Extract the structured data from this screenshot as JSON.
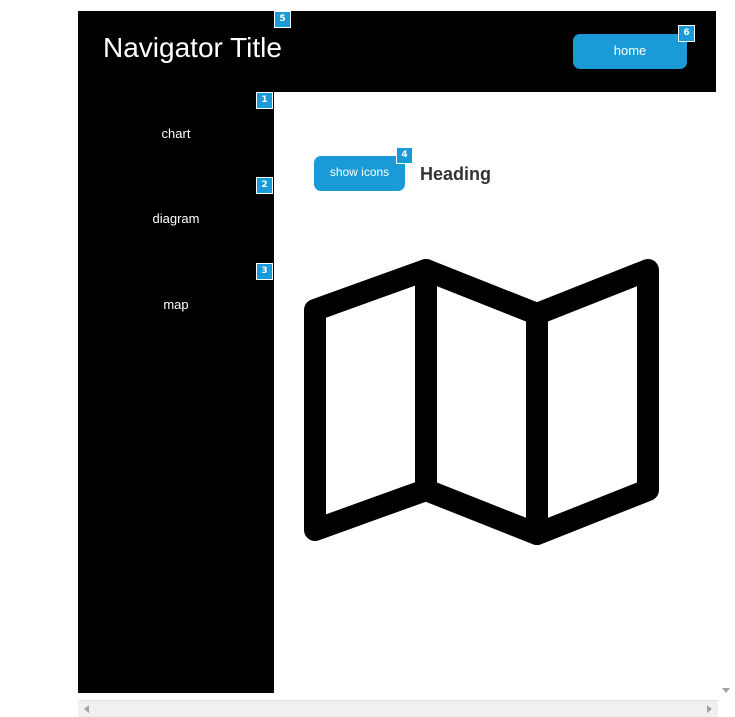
{
  "header": {
    "title": "Navigator Title",
    "home_label": "home"
  },
  "sidebar": {
    "items": [
      {
        "label": "chart"
      },
      {
        "label": "diagram"
      },
      {
        "label": "map"
      }
    ]
  },
  "main": {
    "show_icons_label": "show icons",
    "heading": "Heading",
    "icon": "map-icon"
  },
  "badges": {
    "sidebar_chart": "1",
    "sidebar_diagram": "2",
    "sidebar_map": "3",
    "show_icons": "4",
    "title": "5",
    "home": "6"
  },
  "colors": {
    "accent": "#1a9bd7",
    "nav_background": "#000000",
    "content_background": "#ffffff",
    "heading_text": "#333333"
  }
}
